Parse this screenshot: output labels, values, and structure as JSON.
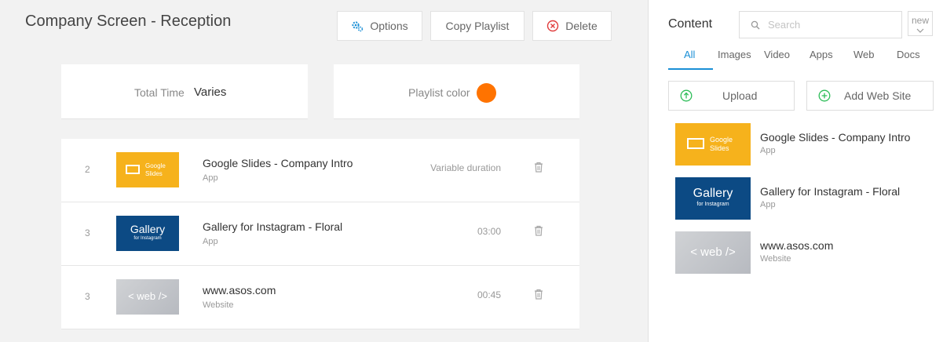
{
  "page": {
    "title": "Company Screen - Reception"
  },
  "toolbar": {
    "options_label": "Options",
    "copy_label": "Copy Playlist",
    "delete_label": "Delete"
  },
  "summary": {
    "total_time_label": "Total Time",
    "total_time_value": "Varies",
    "color_label": "Playlist color",
    "color": "#ff7300"
  },
  "playlist": [
    {
      "num": "2",
      "title": "Google Slides - Company Intro",
      "type": "App",
      "duration": "Variable duration",
      "thumb": "google-slides",
      "thumb_text_1": "Google",
      "thumb_text_2": "Slides"
    },
    {
      "num": "3",
      "title": "Gallery for Instagram - Floral",
      "type": "App",
      "duration": "03:00",
      "thumb": "gallery",
      "thumb_text_1": "Gallery",
      "thumb_text_2": "for Instagram"
    },
    {
      "num": "3",
      "title": "www.asos.com",
      "type": "Website",
      "duration": "00:45",
      "thumb": "web",
      "thumb_text_1": "< web />"
    }
  ],
  "sidebar": {
    "title": "Content",
    "search_placeholder": "Search",
    "new_label": "new",
    "tabs": [
      "All",
      "Images",
      "Video",
      "Apps",
      "Web",
      "Docs"
    ],
    "active_tab": "All",
    "upload_label": "Upload",
    "add_web_label": "Add Web Site",
    "items": [
      {
        "title": "Google Slides - Company Intro",
        "type": "App",
        "thumb_text_1": "Google",
        "thumb_text_2": "Slides"
      },
      {
        "title": "Gallery for Instagram - Floral",
        "type": "App",
        "thumb_text_1": "Gallery",
        "thumb_text_2": "for Instagram"
      },
      {
        "title": "www.asos.com",
        "type": "Website",
        "thumb_text_1": "< web />"
      }
    ]
  },
  "colors": {
    "accent": "#1a8fd6",
    "green": "#2ebd59",
    "red": "#e03c3c",
    "google": "#f6b21c",
    "instagram": "#0c4a84"
  }
}
